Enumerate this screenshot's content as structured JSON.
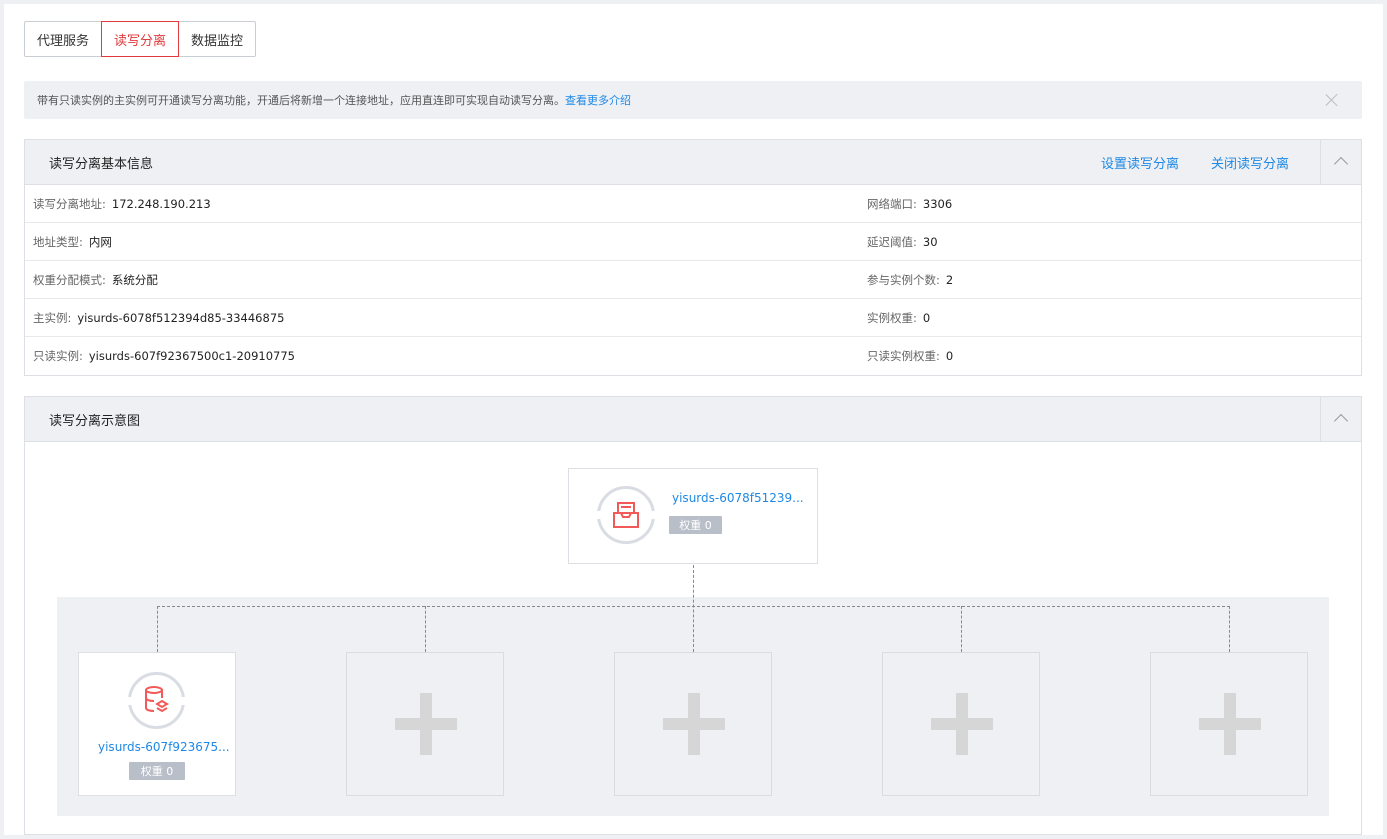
{
  "tabs": [
    {
      "label": "代理服务",
      "active": false
    },
    {
      "label": "读写分离",
      "active": true
    },
    {
      "label": "数据监控",
      "active": false
    }
  ],
  "notice": {
    "text": "带有只读实例的主实例可开通读写分离功能，开通后将新增一个连接地址，应用直连即可实现自动读写分离。",
    "link": "查看更多介绍",
    "close_icon": "close-icon"
  },
  "basic_info": {
    "title": "读写分离基本信息",
    "actions": {
      "configure": "设置读写分离",
      "close": "关闭读写分离"
    },
    "rows": [
      {
        "left_label": "读写分离地址:",
        "left_value": "172.248.190.213",
        "right_label": "网络端口:",
        "right_value": "3306"
      },
      {
        "left_label": "地址类型:",
        "left_value": "内网",
        "right_label": "延迟阈值:",
        "right_value": "30"
      },
      {
        "left_label": "权重分配模式:",
        "left_value": "系统分配",
        "right_label": "参与实例个数:",
        "right_value": "2"
      },
      {
        "left_label": "主实例:",
        "left_value": "yisurds-6078f512394d85-33446875",
        "right_label": "实例权重:",
        "right_value": "0"
      },
      {
        "left_label": "只读实例:",
        "left_value": "yisurds-607f92367500c1-20910775",
        "right_label": "只读实例权重:",
        "right_value": "0"
      }
    ]
  },
  "diagram": {
    "title": "读写分离示意图",
    "master": {
      "name": "yisurds-6078f51239...",
      "weight_label": "权重",
      "weight_value": "0",
      "icon": "master-db-icon"
    },
    "readonly_instances": [
      {
        "name": "yisurds-607f923675...",
        "weight_label": "权重",
        "weight_value": "0",
        "icon": "readonly-db-icon"
      }
    ],
    "empty_slots": 4
  },
  "colors": {
    "accent_red": "#e4393c",
    "link_blue": "#1e88e5",
    "panel_bg": "#eef0f4",
    "badge_gray": "#b9bfc9"
  }
}
